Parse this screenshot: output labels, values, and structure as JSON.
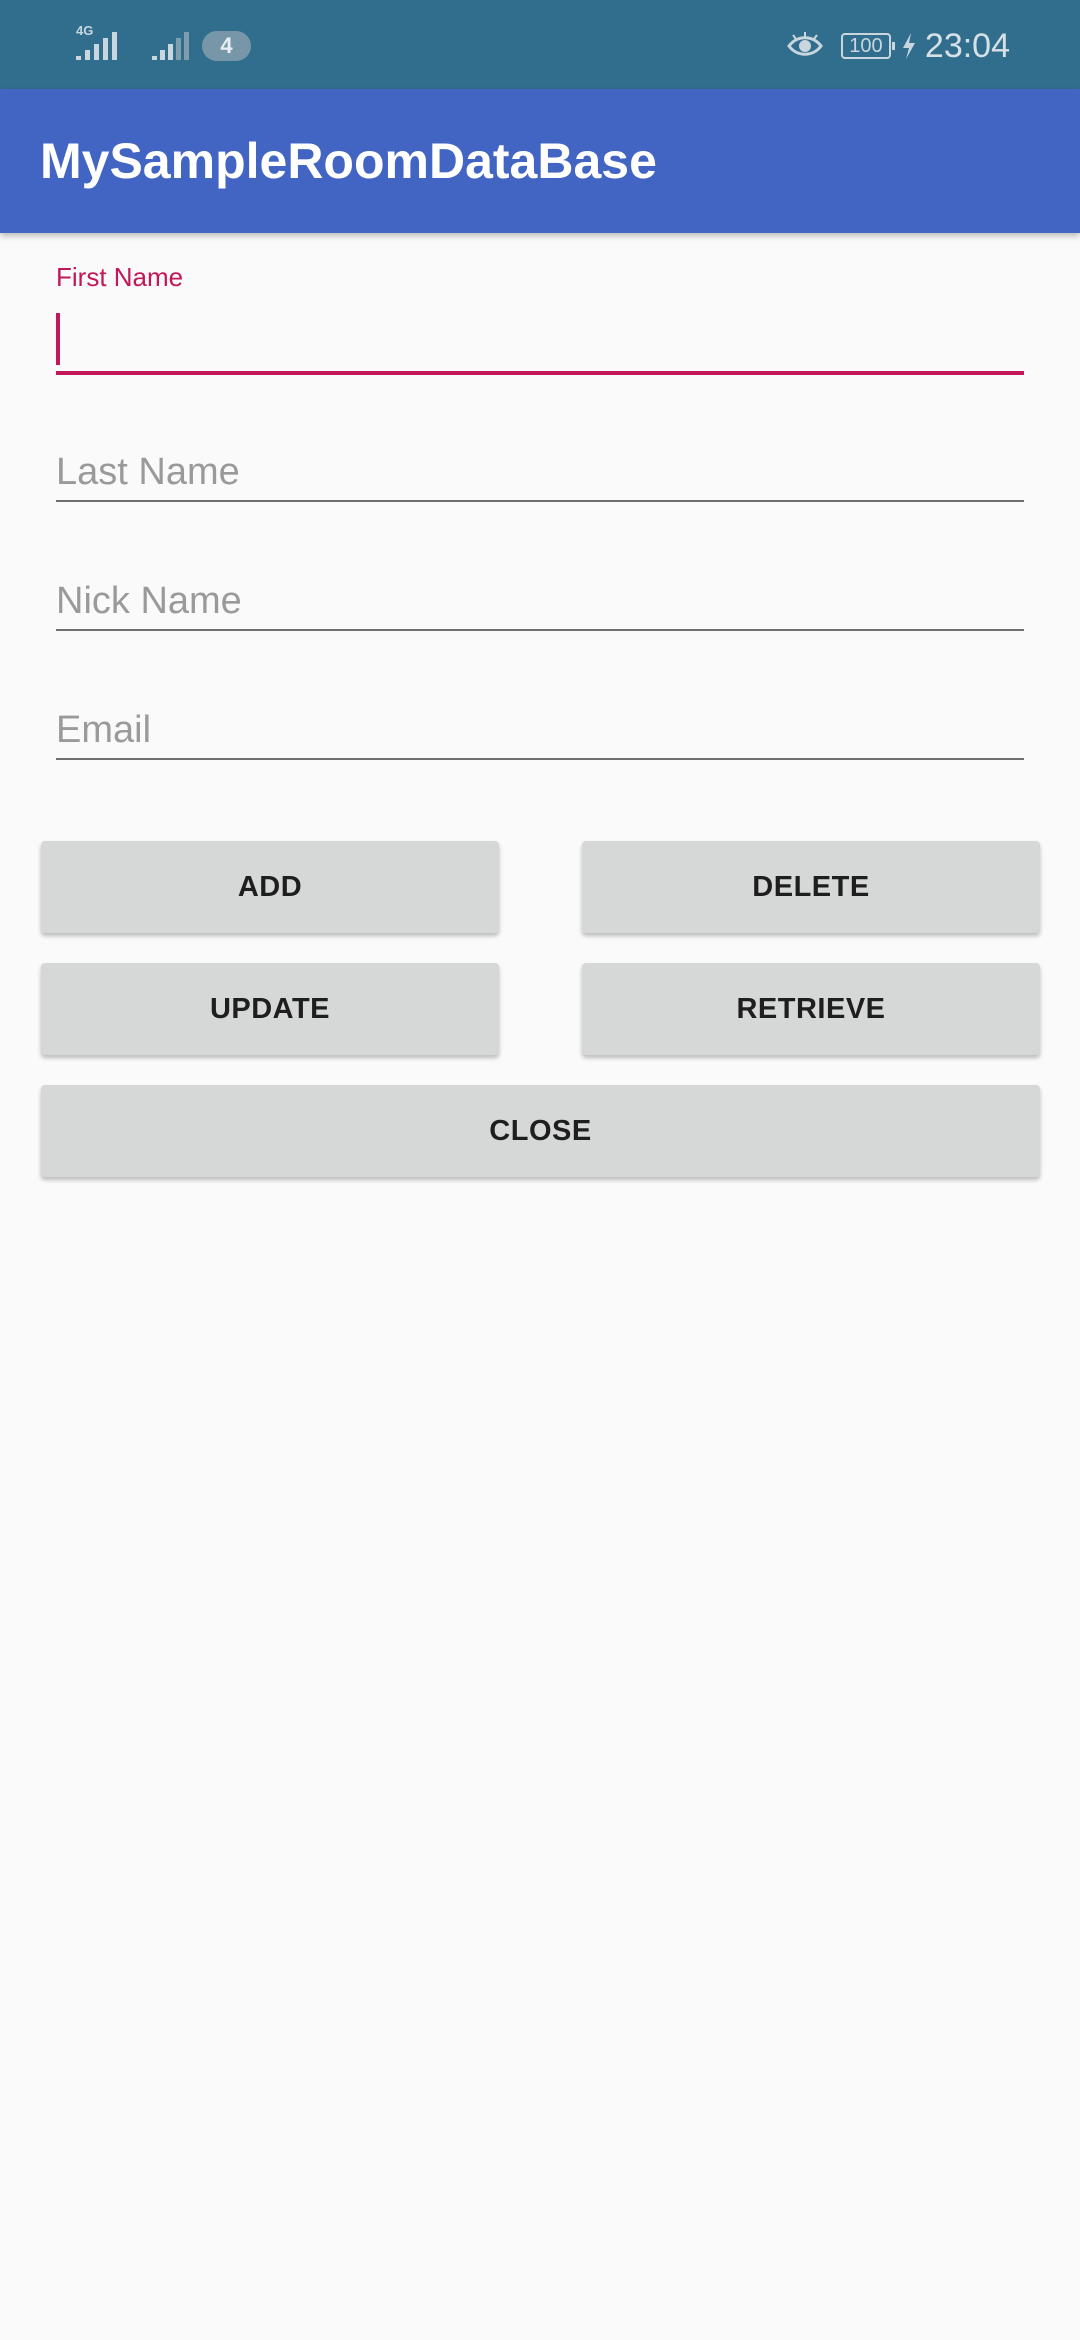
{
  "status_bar": {
    "network_type": "4G",
    "notification_count": "4",
    "battery_level": "100",
    "time": "23:04",
    "icons": [
      "signal-icon",
      "signal-icon",
      "eye-icon",
      "battery-icon",
      "charging-icon"
    ],
    "background_color": "#316e8e"
  },
  "app_bar": {
    "title": "MySampleRoomDataBase",
    "background_color": "#4265c4"
  },
  "form": {
    "first_name": {
      "label": "First Name",
      "value": "",
      "accent_color": "#c2185b"
    },
    "last_name": {
      "placeholder": "Last Name",
      "value": ""
    },
    "nick_name": {
      "placeholder": "Nick Name",
      "value": ""
    },
    "email": {
      "placeholder": "Email",
      "value": ""
    }
  },
  "buttons": {
    "add": "ADD",
    "delete": "DELETE",
    "update": "UPDATE",
    "retrieve": "RETRIEVE",
    "close": "CLOSE"
  }
}
